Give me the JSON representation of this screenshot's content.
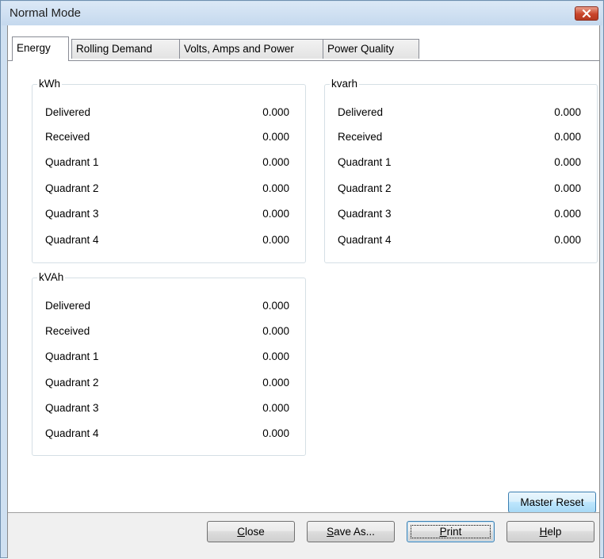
{
  "window": {
    "title": "Normal Mode",
    "close_icon": "close-icon"
  },
  "tabs": [
    {
      "label": "Energy",
      "active": true
    },
    {
      "label": "Rolling Demand",
      "active": false
    },
    {
      "label": "Volts, Amps and Power",
      "active": false
    },
    {
      "label": "Power Quality",
      "active": false
    }
  ],
  "groups": {
    "kwh": {
      "title": "kWh",
      "rows": [
        {
          "label": "Delivered",
          "value": "0.000"
        },
        {
          "label": "Received",
          "value": "0.000"
        },
        {
          "label": "Quadrant 1",
          "value": "0.000"
        },
        {
          "label": "Quadrant 2",
          "value": "0.000"
        },
        {
          "label": "Quadrant 3",
          "value": "0.000"
        },
        {
          "label": "Quadrant 4",
          "value": "0.000"
        }
      ]
    },
    "kvarh": {
      "title": "kvarh",
      "rows": [
        {
          "label": "Delivered",
          "value": "0.000"
        },
        {
          "label": "Received",
          "value": "0.000"
        },
        {
          "label": "Quadrant 1",
          "value": "0.000"
        },
        {
          "label": "Quadrant 2",
          "value": "0.000"
        },
        {
          "label": "Quadrant 3",
          "value": "0.000"
        },
        {
          "label": "Quadrant 4",
          "value": "0.000"
        }
      ]
    },
    "kvah": {
      "title": "kVAh",
      "rows": [
        {
          "label": "Delivered",
          "value": "0.000"
        },
        {
          "label": "Received",
          "value": "0.000"
        },
        {
          "label": "Quadrant 1",
          "value": "0.000"
        },
        {
          "label": "Quadrant 2",
          "value": "0.000"
        },
        {
          "label": "Quadrant 3",
          "value": "0.000"
        },
        {
          "label": "Quadrant 4",
          "value": "0.000"
        }
      ]
    }
  },
  "buttons": {
    "master_reset": "Master Reset",
    "close": {
      "mnemonic": "C",
      "rest": "lose"
    },
    "save_as": {
      "mnemonic": "S",
      "rest": "ave As..."
    },
    "print": {
      "mnemonic": "P",
      "rest": "rint"
    },
    "help": {
      "mnemonic": "H",
      "rest": "elp"
    }
  }
}
